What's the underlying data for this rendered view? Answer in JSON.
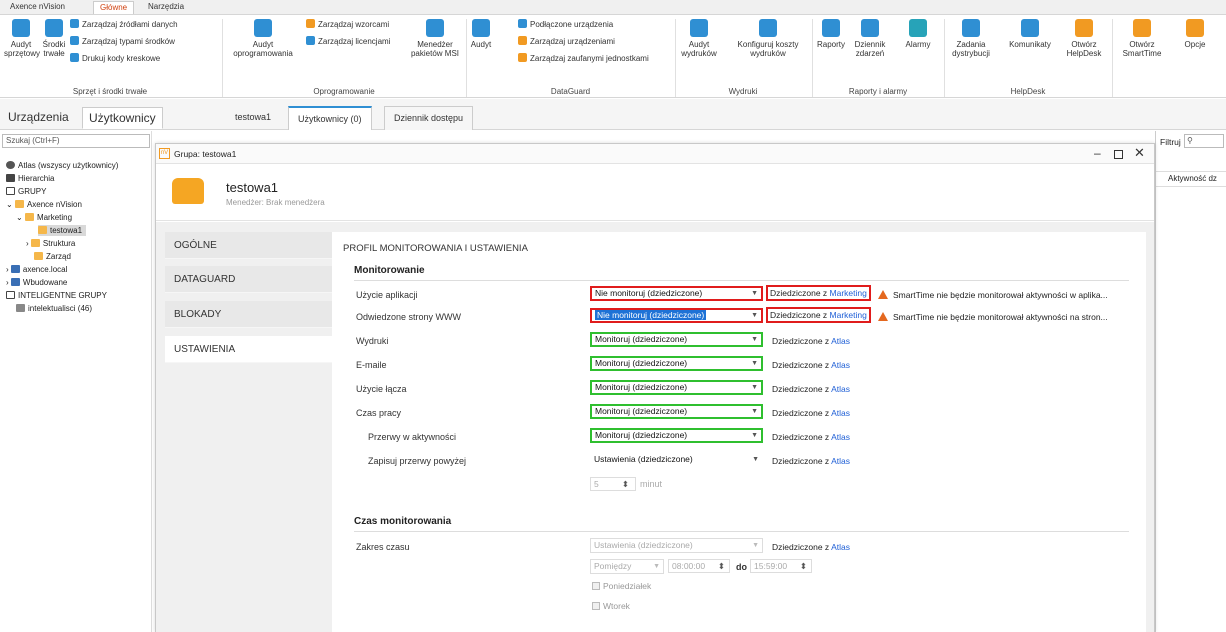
{
  "ribbon": {
    "tabs": [
      "Axence nVision",
      "Główne",
      "Narzędzia"
    ],
    "groups": [
      {
        "label": "Sprzęt i środki trwałe"
      },
      {
        "label": "Oprogramowanie"
      },
      {
        "label": "DataGuard"
      },
      {
        "label": "Wydruki"
      },
      {
        "label": "Raporty i alarmy"
      },
      {
        "label": "HelpDesk"
      }
    ],
    "buttons": {
      "audit_hw": "Audyt sprzętowy",
      "assets": "Środki trwałe",
      "manage_sources": "Zarządzaj źródłami danych",
      "manage_types": "Zarządzaj typami środków",
      "print_barcodes": "Drukuj kody kreskowe",
      "audit_sw": "Audyt oprogramowania",
      "manage_patterns": "Zarządzaj wzorcami",
      "manage_licenses": "Zarządzaj licencjami",
      "msi_manager": "Menedżer pakietów MSI",
      "audit": "Audyt",
      "connected_devices": "Podłączone urządzenia",
      "manage_devices": "Zarządzaj urządzeniami",
      "manage_trusted": "Zarządzaj zaufanymi jednostkami",
      "audit_prints": "Audyt wydruków",
      "config_costs": "Konfiguruj koszty wydruków",
      "reports": "Raporty",
      "event_log": "Dziennik zdarzeń",
      "alarms": "Alarmy",
      "distribution_tasks": "Zadania dystrybucji",
      "messages": "Komunikaty",
      "open_helpdesk": "Otwórz HelpDesk",
      "open_smarttime": "Otwórz SmartTime",
      "options": "Opcje"
    }
  },
  "main_tabs": {
    "devices": "Urządzenia",
    "users": "Użytkownicy"
  },
  "sub_tabs": [
    "testowa1",
    "Użytkownicy (0)",
    "Dziennik dostępu"
  ],
  "search": {
    "placeholder": "Szukaj (Ctrl+F)"
  },
  "tree": [
    {
      "label": "Atlas (wszyscy użytkownicy)"
    },
    {
      "label": "Hierarchia"
    },
    {
      "label": "GRUPY"
    },
    {
      "label": "Axence nVision"
    },
    {
      "label": "Marketing"
    },
    {
      "label": "testowa1"
    },
    {
      "label": "Struktura"
    },
    {
      "label": "Zarząd"
    },
    {
      "label": "axence.local"
    },
    {
      "label": "Wbudowane"
    },
    {
      "label": "INTELIGENTNE GRUPY"
    },
    {
      "label": "intelektualisci (46)"
    }
  ],
  "right_panel": {
    "filter_label": "Filtruj",
    "column_header": "Aktywność dz"
  },
  "dialog": {
    "title": "Grupa: testowa1",
    "group_name": "testowa1",
    "manager": "Menedżer: Brak menedżera",
    "side_tabs": [
      "OGÓLNE",
      "DATAGUARD",
      "BLOKADY",
      "USTAWIENIA"
    ],
    "content_title": "PROFIL MONITOROWANIA I USTAWIENIA",
    "section_monitoring": "Monitorowanie",
    "section_time": "Czas monitorowania",
    "inherited_prefix": "Dziedziczone z",
    "rows": [
      {
        "label": "Użycie aplikacji",
        "value": "Nie monitoruj (dziedziczone)",
        "source": "Marketing",
        "warning": "SmartTime nie będzie monitorował aktywności w aplika..."
      },
      {
        "label": "Odwiedzone strony WWW",
        "value": "Nie monitoruj (dziedziczone)",
        "source": "Marketing",
        "warning": "SmartTime nie będzie monitorował aktywności na stron..."
      },
      {
        "label": "Wydruki",
        "value": "Monitoruj (dziedziczone)",
        "source": "Atlas"
      },
      {
        "label": "E-maile",
        "value": "Monitoruj (dziedziczone)",
        "source": "Atlas"
      },
      {
        "label": "Użycie łącza",
        "value": "Monitoruj (dziedziczone)",
        "source": "Atlas"
      },
      {
        "label": "Czas pracy",
        "value": "Monitoruj (dziedziczone)",
        "source": "Atlas"
      },
      {
        "label": "Przerwy w aktywności",
        "value": "Monitoruj (dziedziczone)",
        "source": "Atlas"
      },
      {
        "label": "Zapisuj przerwy powyżej",
        "value": "Ustawienia (dziedziczone)",
        "source": "Atlas"
      }
    ],
    "break_minutes": {
      "value": "5",
      "unit": "minut"
    },
    "time_range": {
      "label": "Zakres czasu",
      "value": "Ustawienia (dziedziczone)",
      "source": "Atlas",
      "mode": "Pomiędzy",
      "from": "08:00:00",
      "to_label": "do",
      "to": "15:59:00",
      "days": [
        "Poniedziałek",
        "Wtorek"
      ]
    }
  },
  "colors": {
    "accent": "#2f8fd3",
    "error_border": "#e01c1c",
    "ok_border": "#2fbf2f",
    "link": "#1f5fd6",
    "warning": "#e4681f"
  }
}
